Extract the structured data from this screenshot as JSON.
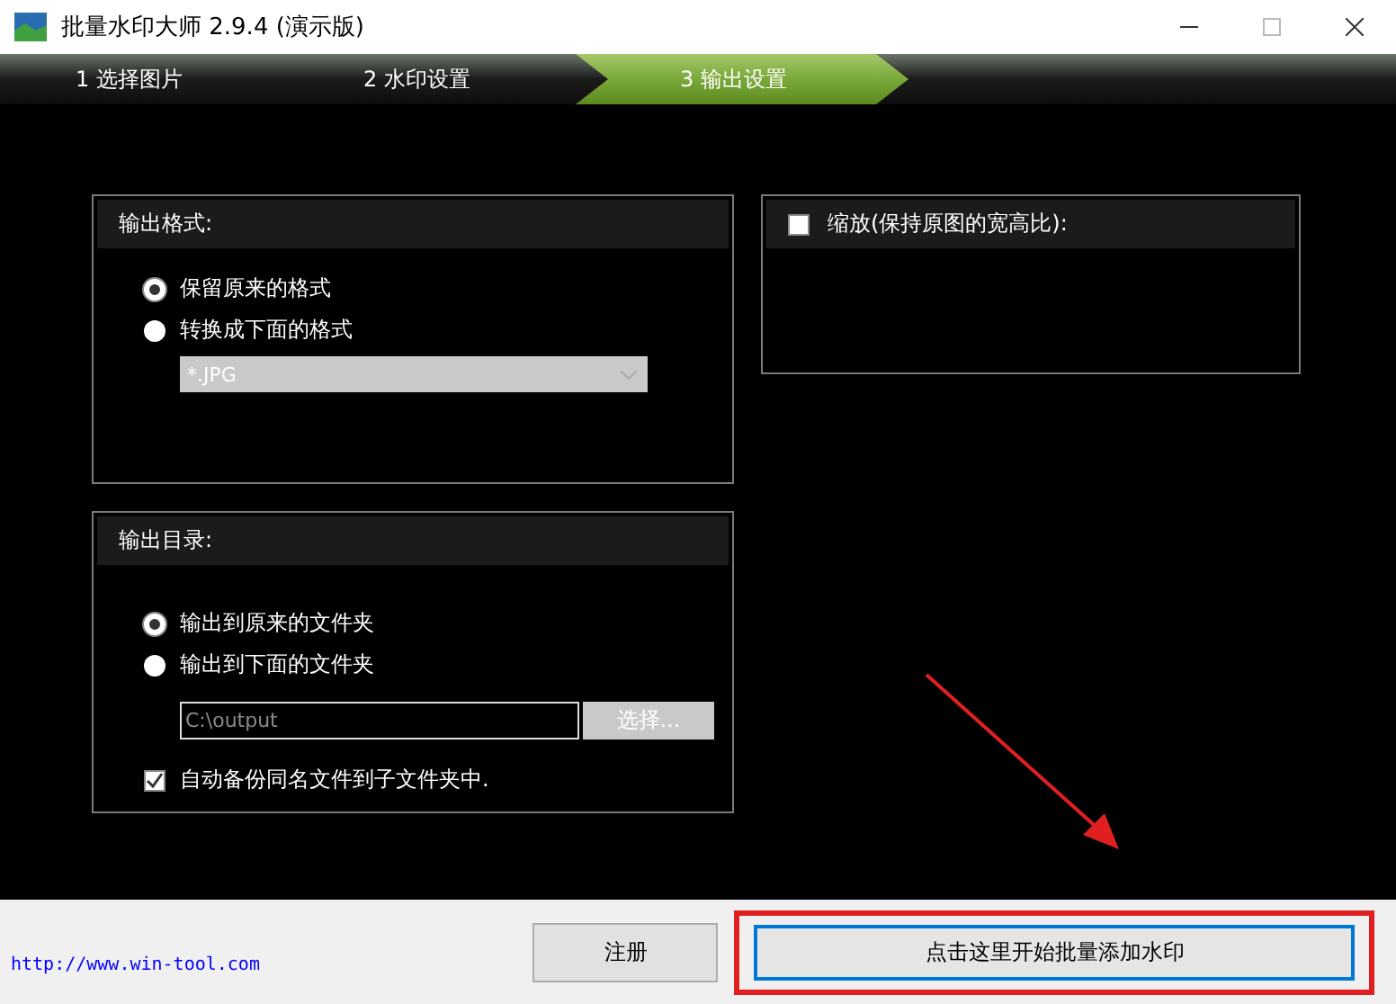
{
  "window": {
    "title": "批量水印大师 2.9.4 (演示版)"
  },
  "steps": [
    {
      "label": "1  选择图片",
      "selected": false
    },
    {
      "label": "2  水印设置",
      "selected": false
    },
    {
      "label": "3  输出设置",
      "selected": true
    }
  ],
  "output_format": {
    "title": "输出格式:",
    "options": [
      {
        "label": "保留原来的格式",
        "selected": true
      },
      {
        "label": "转换成下面的格式",
        "selected": false
      }
    ],
    "format_value": "*.JPG"
  },
  "output_dir": {
    "title": "输出目录:",
    "options": [
      {
        "label": "输出到原来的文件夹",
        "selected": true
      },
      {
        "label": "输出到下面的文件夹",
        "selected": false
      }
    ],
    "path_value": "C:\\output",
    "browse_button": "选择...",
    "backup": {
      "label": "自动备份同名文件到子文件夹中.",
      "checked": true
    }
  },
  "resize": {
    "label": "缩放(保持原图的宽高比):",
    "checked": false
  },
  "footer": {
    "link": "http://www.win-tool.com",
    "register_button": "注册",
    "start_button": "点击这里开始批量添加水印"
  }
}
